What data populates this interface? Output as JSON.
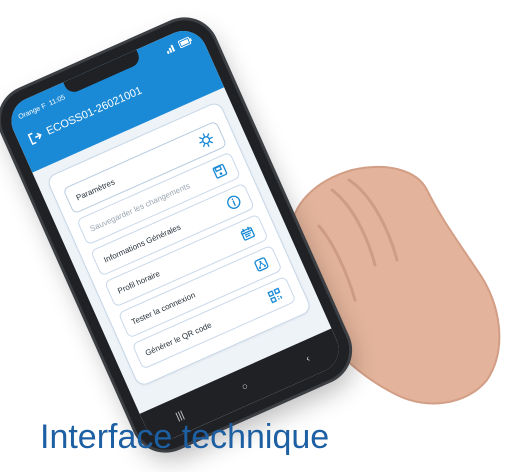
{
  "status": {
    "carrier": "Orange F",
    "time": "11:05"
  },
  "app": {
    "title": "ECOSS01-26021001"
  },
  "menu": [
    {
      "label": "Paramètres",
      "icon": "gear-icon",
      "disabled": false
    },
    {
      "label": "Sauvegarder les changements",
      "icon": "save-icon",
      "disabled": true
    },
    {
      "label": "Informations Générales",
      "icon": "info-icon",
      "disabled": false
    },
    {
      "label": "Profil horaire",
      "icon": "calendar-icon",
      "disabled": false
    },
    {
      "label": "Tester la connexion",
      "icon": "network-icon",
      "disabled": false
    },
    {
      "label": "Générer le QR code",
      "icon": "qr-icon",
      "disabled": false
    }
  ],
  "caption": "Interface technique",
  "colors": {
    "appbar": "#1b8ad6",
    "caption": "#1d5fa3",
    "accent": "#1b8ad6"
  }
}
